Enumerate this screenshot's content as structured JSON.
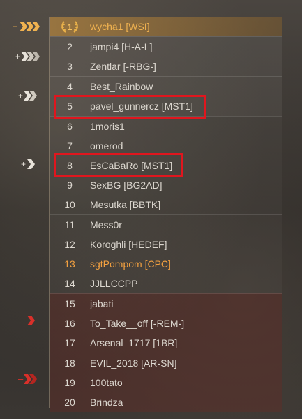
{
  "leaderboard": {
    "rows": [
      {
        "rank": "1",
        "name": "wycha1 [WSI]"
      },
      {
        "rank": "2",
        "name": "jampi4 [H-A-L]"
      },
      {
        "rank": "3",
        "name": "Zentlar [-RBG-]"
      },
      {
        "rank": "4",
        "name": "Best_Rainbow"
      },
      {
        "rank": "5",
        "name": "pavel_gunnercz [MST1]"
      },
      {
        "rank": "6",
        "name": "1moris1"
      },
      {
        "rank": "7",
        "name": "omerod"
      },
      {
        "rank": "8",
        "name": "EsCaBaRo [MST1]"
      },
      {
        "rank": "9",
        "name": "SexBG [BG2AD]"
      },
      {
        "rank": "10",
        "name": "Mesutka [BBTK]"
      },
      {
        "rank": "11",
        "name": "Mess0r"
      },
      {
        "rank": "12",
        "name": "Koroghli [HEDEF]"
      },
      {
        "rank": "13",
        "name": "sgtPompom [CPC]"
      },
      {
        "rank": "14",
        "name": "JJLLCCPP"
      },
      {
        "rank": "15",
        "name": "jabati"
      },
      {
        "rank": "16",
        "name": "To_Take__off [-REM-]"
      },
      {
        "rank": "17",
        "name": "Arsenal_1717 [1BR]"
      },
      {
        "rank": "18",
        "name": "EVIL_2018 [AR-SN]"
      },
      {
        "rank": "19",
        "name": "100tato"
      },
      {
        "rank": "20",
        "name": "Brindza"
      }
    ]
  },
  "markers": {
    "up_chevrons": [
      "+3",
      "+3",
      "+2",
      "+1"
    ],
    "down_chevrons": [
      "-1",
      "-2"
    ]
  },
  "colors": {
    "gold": "#f0b250",
    "self": "#f2a040",
    "highlight": "#e0161e",
    "up": "#e8e3da",
    "down": "#d9302a"
  }
}
